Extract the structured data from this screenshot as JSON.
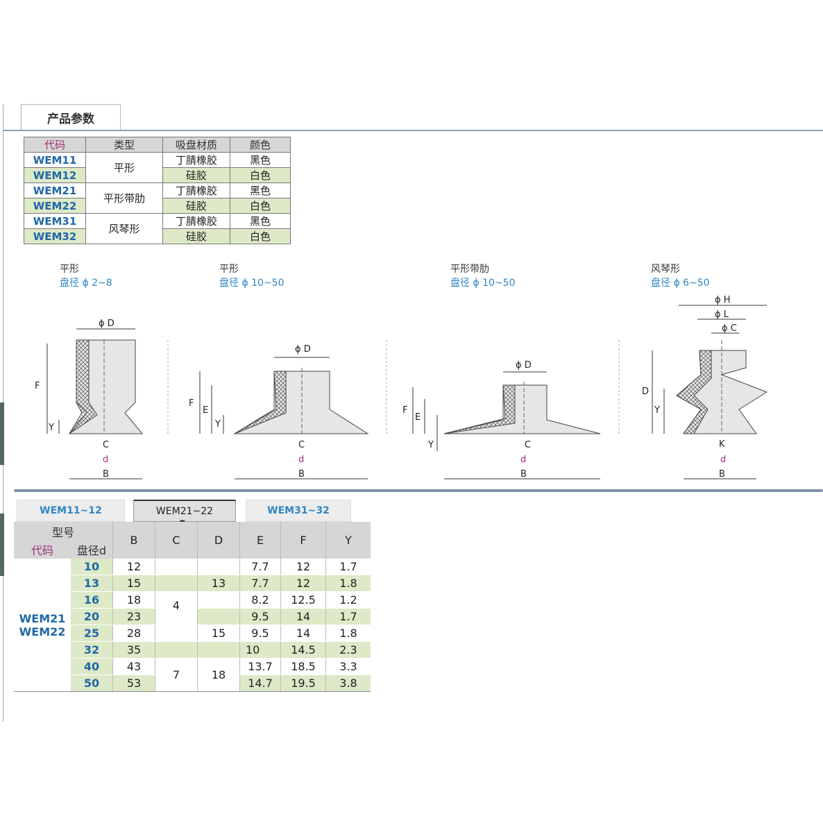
{
  "header": {
    "tab_label": "产品参数"
  },
  "spec_table": {
    "headers": [
      "代码",
      "类型",
      "吸盘材质",
      "颜色"
    ],
    "rows": [
      {
        "code": "WEM11",
        "type": "平形",
        "material": "丁腈橡胶",
        "color": "黑色"
      },
      {
        "code": "WEM12",
        "type": "",
        "material": "硅胶",
        "color": "白色"
      },
      {
        "code": "WEM21",
        "type": "平形带肋",
        "material": "丁腈橡胶",
        "color": "黑色"
      },
      {
        "code": "WEM22",
        "type": "",
        "material": "硅胶",
        "color": "白色"
      },
      {
        "code": "WEM31",
        "type": "风琴形",
        "material": "丁腈橡胶",
        "color": "黑色"
      },
      {
        "code": "WEM32",
        "type": "",
        "material": "硅胶",
        "color": "白色"
      }
    ]
  },
  "diagrams": [
    {
      "title": "平形",
      "subtitle": "盘径 ϕ 2~8"
    },
    {
      "title": "平形",
      "subtitle": "盘径 ϕ 10~50"
    },
    {
      "title": "平形带肋",
      "subtitle": "盘径 ϕ 10~50"
    },
    {
      "title": "风琴形",
      "subtitle": "盘径 ϕ 6~50"
    }
  ],
  "dim_labels": {
    "D": "ϕ D",
    "H": "ϕ H",
    "L": "ϕ L",
    "C": "ϕ C",
    "F": "F",
    "E": "E",
    "Y": "Y",
    "Cplain": "C",
    "d": "d",
    "B": "B",
    "K": "K",
    "Dplain": "D"
  },
  "bottom_tabs": [
    "WEM11~12",
    "WEM21~22",
    "WEM31~32"
  ],
  "dims_table": {
    "header_model": "型号",
    "header_code": "代码",
    "header_dia": "盘径d",
    "columns": [
      "B",
      "C",
      "D",
      "E",
      "F",
      "Y"
    ],
    "code_lines": [
      "WEM21",
      "WEM22"
    ],
    "rows": [
      {
        "d": "10",
        "B": "12",
        "E": "7.7",
        "F": "12",
        "Y": "1.7"
      },
      {
        "d": "13",
        "B": "15",
        "E": "7.7",
        "F": "12",
        "Y": "1.8"
      },
      {
        "d": "16",
        "B": "18",
        "E": "8.2",
        "F": "12.5",
        "Y": "1.2"
      },
      {
        "d": "20",
        "B": "23",
        "E": "9.5",
        "F": "14",
        "Y": "1.7"
      },
      {
        "d": "25",
        "B": "28",
        "E": "9.5",
        "F": "14",
        "Y": "1.8"
      },
      {
        "d": "32",
        "B": "35",
        "E": "10",
        "F": "14.5",
        "Y": "2.3"
      },
      {
        "d": "40",
        "B": "43",
        "E": "13.7",
        "F": "18.5",
        "Y": "3.3"
      },
      {
        "d": "50",
        "B": "53",
        "E": "14.7",
        "F": "19.5",
        "Y": "3.8"
      }
    ],
    "C_groups": [
      "4",
      "7"
    ],
    "D_groups": [
      "13",
      "15",
      "18"
    ]
  }
}
